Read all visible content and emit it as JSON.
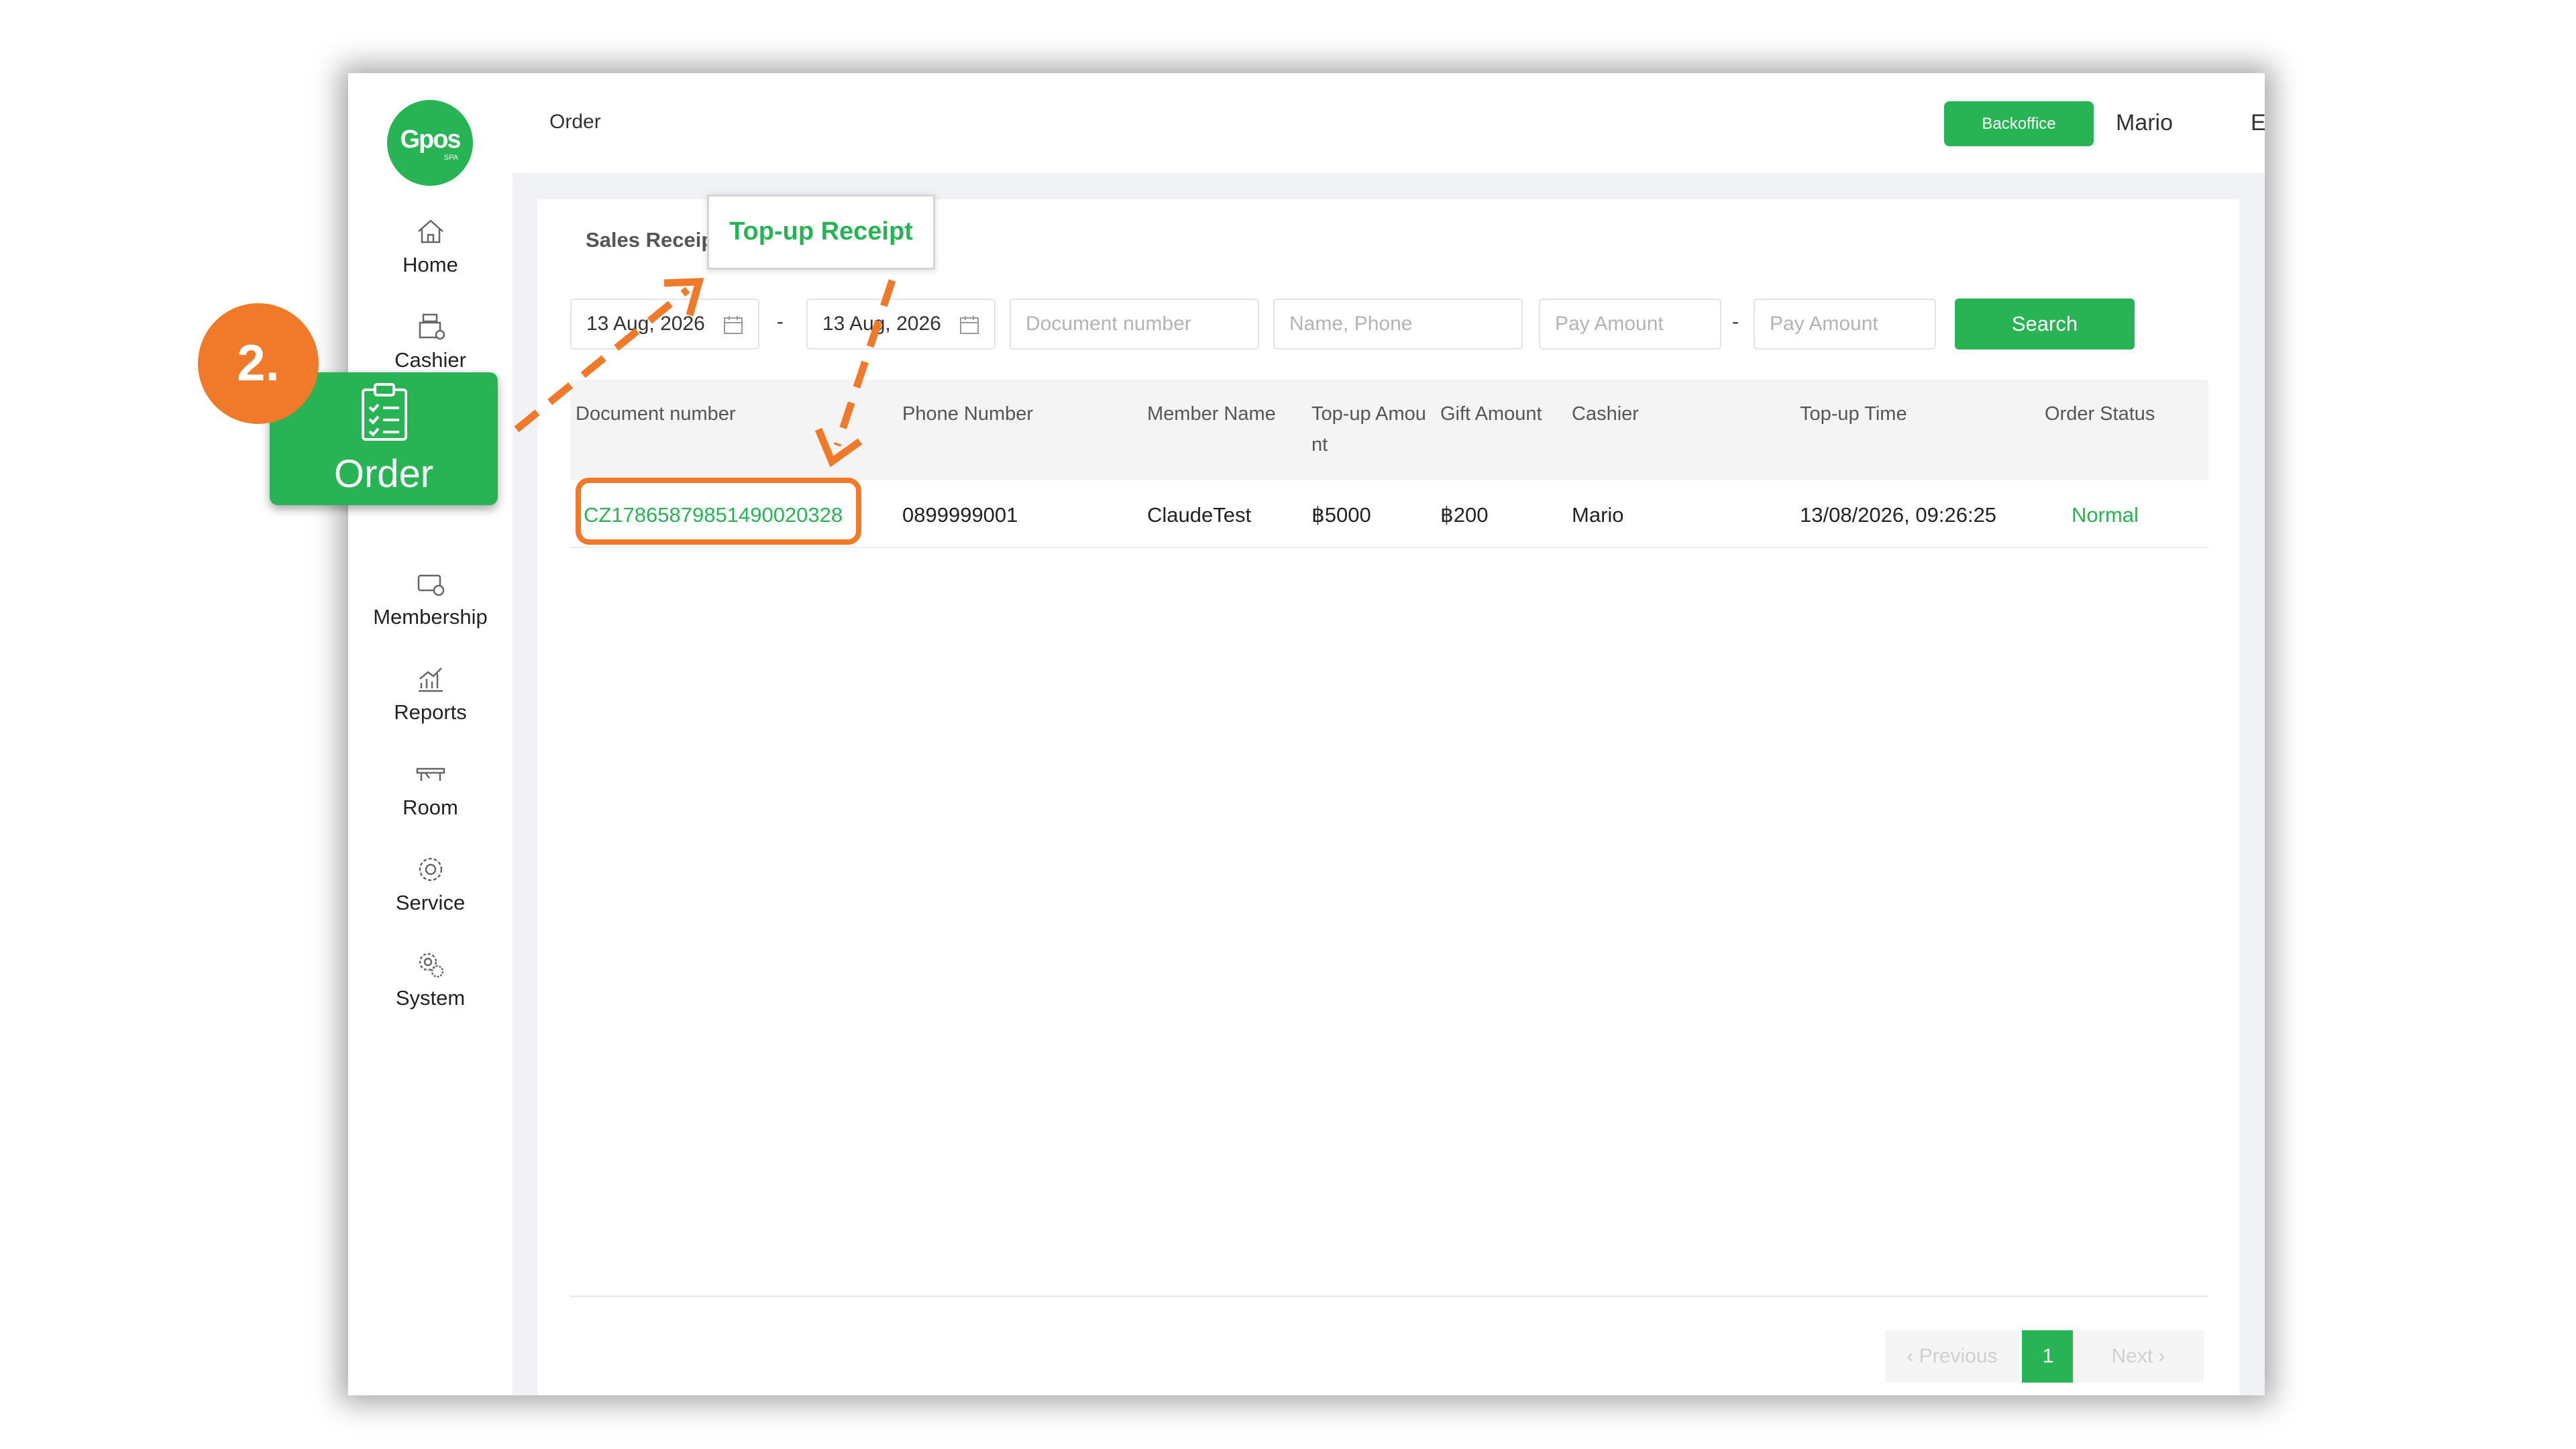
{
  "sidebar": {
    "logo": {
      "main": "Gpos",
      "sub": "SPA"
    },
    "items": [
      {
        "label": "Home",
        "icon": "home-icon"
      },
      {
        "label": "Cashier",
        "icon": "cash-register-icon"
      },
      {
        "label": "Order",
        "icon": "clipboard-icon"
      },
      {
        "label": "Membership",
        "icon": "member-card-icon"
      },
      {
        "label": "Reports",
        "icon": "chart-icon"
      },
      {
        "label": "Room",
        "icon": "bed-icon"
      },
      {
        "label": "Service",
        "icon": "service-icon"
      },
      {
        "label": "System",
        "icon": "gear-icon"
      }
    ]
  },
  "header": {
    "title": "Order",
    "backoffice_label": "Backoffice",
    "user": "Mario",
    "language": "EN"
  },
  "tabs": {
    "sales": "Sales Receipt",
    "topup": "Top-up Receipt"
  },
  "filters": {
    "start_date": "13 Aug, 2026",
    "end_date": "13 Aug, 2026",
    "date_separator": "-",
    "document_placeholder": "Document number",
    "name_phone_placeholder": "Name, Phone",
    "pay_amount_min_placeholder": "Pay Amount",
    "amount_separator": "-",
    "pay_amount_max_placeholder": "Pay Amount",
    "search_label": "Search"
  },
  "table": {
    "columns": [
      "Document number",
      "Phone Number",
      "Member Name",
      "Top-up Amou\nnt",
      "Gift Amount",
      "Cashier",
      "Top-up Time",
      "Order Status"
    ],
    "rows": [
      {
        "document": "CZ17865879851490020328",
        "phone": "0899999001",
        "member": "ClaudeTest",
        "topup_amount": "฿5000",
        "gift_amount": "฿200",
        "cashier": "Mario",
        "topup_time": "13/08/2026, 09:26:25",
        "status": "Normal"
      }
    ]
  },
  "pagination": {
    "previous": "Previous",
    "current": "1",
    "next": "Next"
  },
  "annotation": {
    "step": "2.",
    "callout_label": "Order"
  },
  "colors": {
    "brand": "#28b354",
    "annotation": "#f07a2a"
  }
}
